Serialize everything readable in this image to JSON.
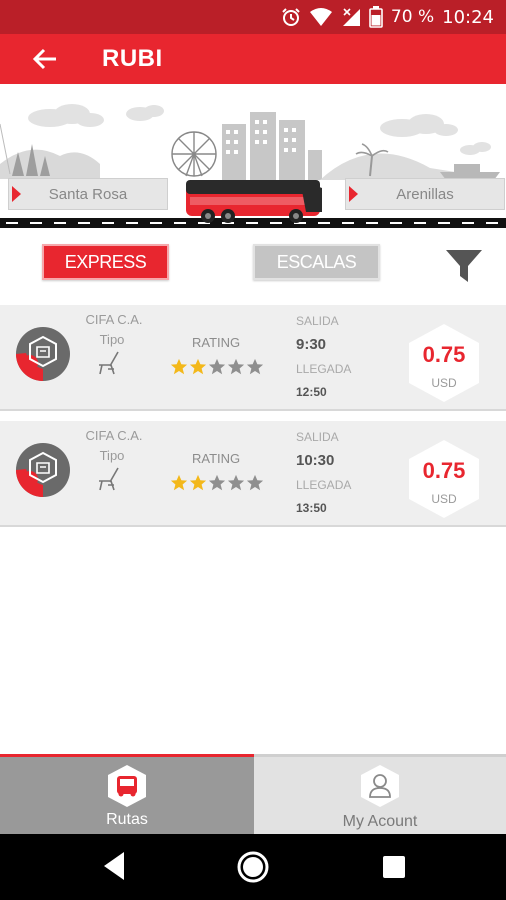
{
  "status_bar": {
    "battery": "70 %",
    "time": "10:24",
    "icons": [
      "alarm-icon",
      "wifi-icon",
      "signal-icon",
      "battery-icon"
    ]
  },
  "app_bar": {
    "title": "RUBI",
    "back_icon": "arrow-left-icon"
  },
  "route": {
    "origin": "Santa Rosa",
    "destination": "Arenillas"
  },
  "filters": {
    "express_label": "EXPRESS",
    "escalas_label": "ESCALAS",
    "selected": "EXPRESS",
    "filter_icon": "funnel-icon"
  },
  "results": [
    {
      "company": "CIFA C.A.",
      "tipo_label": "Tipo",
      "rating_label": "RATING",
      "rating": 2,
      "rating_max": 5,
      "departure_label": "SALIDA",
      "departure_time": "9:30",
      "arrival_label": "LLEGADA",
      "arrival_time": "12:50",
      "price": "0.75",
      "currency": "USD"
    },
    {
      "company": "CIFA C.A.",
      "tipo_label": "Tipo",
      "rating_label": "RATING",
      "rating": 2,
      "rating_max": 5,
      "departure_label": "SALIDA",
      "departure_time": "10:30",
      "arrival_label": "LLEGADA",
      "arrival_time": "13:50",
      "price": "0.75",
      "currency": "USD"
    }
  ],
  "bottom_nav": {
    "tabs": [
      {
        "label": "Rutas",
        "icon": "bus-icon",
        "active": true
      },
      {
        "label": "My Acount",
        "icon": "user-icon",
        "active": false
      }
    ]
  },
  "colors": {
    "brand_red": "#e8262f",
    "status_red": "#ba1f28",
    "star_gold": "#f3b81a",
    "star_grey": "#8f8f8f"
  }
}
